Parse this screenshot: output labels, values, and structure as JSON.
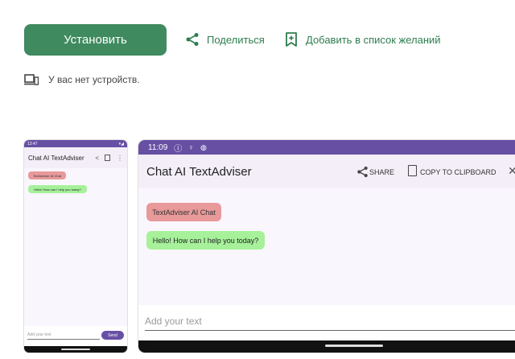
{
  "header": {
    "install_label": "Установить",
    "share_label": "Поделиться",
    "wishlist_label": "Добавить в список желаний",
    "devices_text": "У вас нет устройств."
  },
  "screenshot_small": {
    "status_time": "13:47",
    "title": "Chat AI TextAdviser",
    "bubble_app": "TextAdviser AI Chat",
    "bubble_greeting": "Hello! How can I help you today?",
    "input_placeholder": "Add your text",
    "send_label": "Send"
  },
  "screenshot_large": {
    "status_time": "11:09",
    "title": "Chat AI TextAdviser",
    "share_label": "SHARE",
    "copy_label": "COPY TO CLIPBOARD",
    "bubble_app": "TextAdviser AI Chat",
    "bubble_greeting": "Hello! How can I help you today?",
    "input_placeholder": "Add your text"
  },
  "colors": {
    "accent_green": "#3f8a5f",
    "status_purple": "#6750a4",
    "bubble_red": "#e89999",
    "bubble_green": "#a6f19a"
  }
}
